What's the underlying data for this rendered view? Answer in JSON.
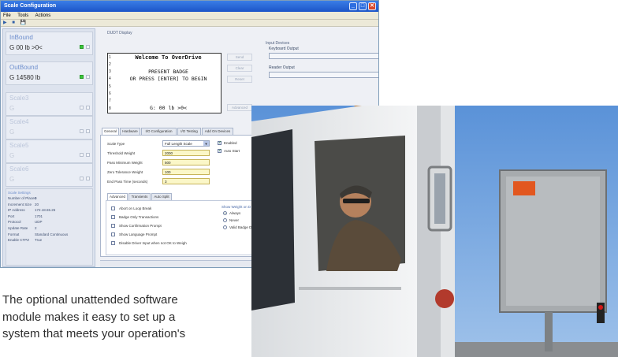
{
  "window": {
    "title": "Scale Configuration",
    "controls": [
      "_",
      "□",
      "✕"
    ],
    "menu": [
      "File",
      "Tools",
      "Actions"
    ],
    "toolbar": [
      "▶",
      "■",
      "💾"
    ]
  },
  "scales": [
    {
      "name": "InBound",
      "reading": "G  00  lb    >0<",
      "active": true
    },
    {
      "name": "OutBound",
      "reading": "G  14580  lb",
      "active": true
    },
    {
      "name": "Scale3",
      "reading": "G",
      "active": false
    },
    {
      "name": "Scale4",
      "reading": "G",
      "active": false
    },
    {
      "name": "Scale5",
      "reading": "G",
      "active": false
    },
    {
      "name": "Scale6",
      "reading": "G",
      "active": false
    }
  ],
  "scale_settings": {
    "heading": "Scale Settings",
    "rows": [
      {
        "label": "Number of Places",
        "value": "0"
      },
      {
        "label": "Increment Size",
        "value": "20"
      },
      {
        "label": "IP Address",
        "value": "172.18.65.26"
      },
      {
        "label": "Port",
        "value": "1701"
      },
      {
        "label": "Protocol",
        "value": "UDP"
      },
      {
        "label": "Update Rate",
        "value": "2"
      },
      {
        "label": "Format",
        "value": "Standard Continuous"
      },
      {
        "label": "Enable CTPZ",
        "value": "True"
      }
    ]
  },
  "dudt": {
    "label": "DUDT Display",
    "lines": [
      "Welcome To OverDrive",
      "",
      "PRESENT BADGE",
      "OR PRESS [ENTER] TO BEGIN",
      "",
      "",
      "",
      "G: 00  lb    >0<"
    ],
    "line_numbers": [
      "1",
      "2",
      "3",
      "4",
      "5",
      "6",
      "7",
      "8"
    ],
    "buttons": [
      "Send",
      "Clear",
      "Reset"
    ],
    "advanced_button": "Advanced"
  },
  "input_devices": {
    "label": "Input Devices",
    "fields": [
      "Keyboard Output",
      "Reader Output"
    ]
  },
  "tabs": [
    "General",
    "Hardware",
    "I/O Configuration",
    "I/O Testing",
    "Add On Devices"
  ],
  "general": {
    "fields": [
      {
        "label": "Scale Type",
        "value": "Full Length Scale"
      },
      {
        "label": "Threshold Weight",
        "value": "2000"
      },
      {
        "label": "Pass Minimum Weight",
        "value": "500"
      },
      {
        "label": "Zero Tolerance Weight",
        "value": "100"
      },
      {
        "label": "End Pass Time (seconds)",
        "value": "3"
      }
    ],
    "checks": [
      {
        "label": "Enabled",
        "checked": true
      },
      {
        "label": "Auto Start",
        "checked": true
      }
    ]
  },
  "subtabs": [
    "Advanced",
    "Transients",
    "Auto Split"
  ],
  "advanced_options": [
    "Abort on Loop Break",
    "Badge Only Transactions",
    "Show Confirmation Prompt",
    "Show Language Prompt",
    "Disable Driver Input when not OK to Weigh"
  ],
  "show_weight": {
    "label": "Show Weight on D",
    "options": [
      {
        "label": "Always",
        "selected": true
      },
      {
        "label": "Never",
        "selected": false
      },
      {
        "label": "Valid Badge D",
        "selected": false
      }
    ]
  },
  "caption": {
    "lines": [
      "The optional unattended software",
      "module makes it easy to set up a",
      "system that meets your operation's"
    ]
  }
}
